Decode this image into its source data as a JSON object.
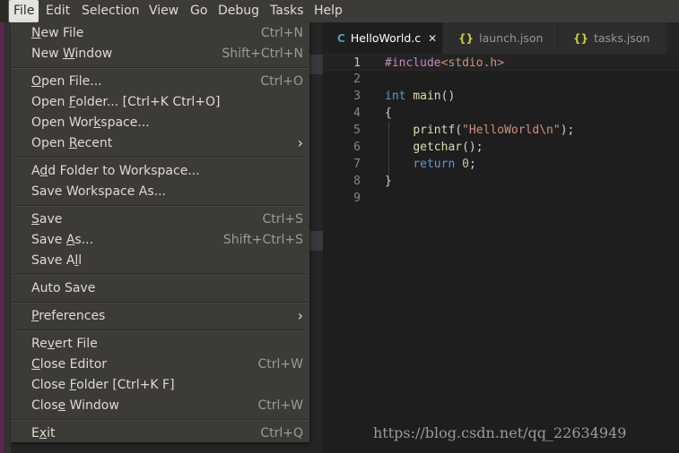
{
  "menubar": {
    "items": [
      "File",
      "Edit",
      "Selection",
      "View",
      "Go",
      "Debug",
      "Tasks",
      "Help"
    ]
  },
  "tabs": [
    {
      "icon": "C",
      "label": "HelloWorld.c",
      "close": "✕"
    },
    {
      "icon": "{}",
      "label": "launch.json"
    },
    {
      "icon": "{}",
      "label": "tasks.json"
    }
  ],
  "editor": {
    "line_numbers": [
      "1",
      "2",
      "3",
      "4",
      "5",
      "6",
      "7",
      "8",
      "9"
    ]
  },
  "file_menu": {
    "items": [
      {
        "pre": "",
        "u": "N",
        "post": "ew File",
        "shortcut": "Ctrl+N"
      },
      {
        "pre": "New ",
        "u": "W",
        "post": "indow",
        "shortcut": "Shift+Ctrl+N"
      },
      {
        "pre": "",
        "u": "O",
        "post": "pen File...",
        "shortcut": "Ctrl+O"
      },
      {
        "pre": "Open ",
        "u": "F",
        "post": "older... [Ctrl+K Ctrl+O]",
        "shortcut": ""
      },
      {
        "pre": "Open Wor",
        "u": "k",
        "post": "space...",
        "shortcut": ""
      },
      {
        "pre": "Open ",
        "u": "R",
        "post": "ecent",
        "shortcut": ""
      },
      {
        "pre": "A",
        "u": "d",
        "post": "d Folder to Workspace...",
        "shortcut": ""
      },
      {
        "pre": "Save Workspace As...",
        "u": "",
        "post": "",
        "shortcut": ""
      },
      {
        "pre": "",
        "u": "S",
        "post": "ave",
        "shortcut": "Ctrl+S"
      },
      {
        "pre": "Save ",
        "u": "A",
        "post": "s...",
        "shortcut": "Shift+Ctrl+S"
      },
      {
        "pre": "Save A",
        "u": "l",
        "post": "l",
        "shortcut": ""
      },
      {
        "pre": "Auto Save",
        "u": "",
        "post": "",
        "shortcut": ""
      },
      {
        "pre": "",
        "u": "P",
        "post": "references",
        "shortcut": ""
      },
      {
        "pre": "Re",
        "u": "v",
        "post": "ert File",
        "shortcut": ""
      },
      {
        "pre": "",
        "u": "C",
        "post": "lose Editor",
        "shortcut": "Ctrl+W"
      },
      {
        "pre": "Close ",
        "u": "F",
        "post": "older [Ctrl+K F]",
        "shortcut": ""
      },
      {
        "pre": "Clos",
        "u": "e",
        "post": " Window",
        "shortcut": "Ctrl+W"
      },
      {
        "pre": "E",
        "u": "x",
        "post": "it",
        "shortcut": "Ctrl+Q"
      }
    ]
  },
  "watermark": "https://blog.csdn.net/qq_22634949"
}
